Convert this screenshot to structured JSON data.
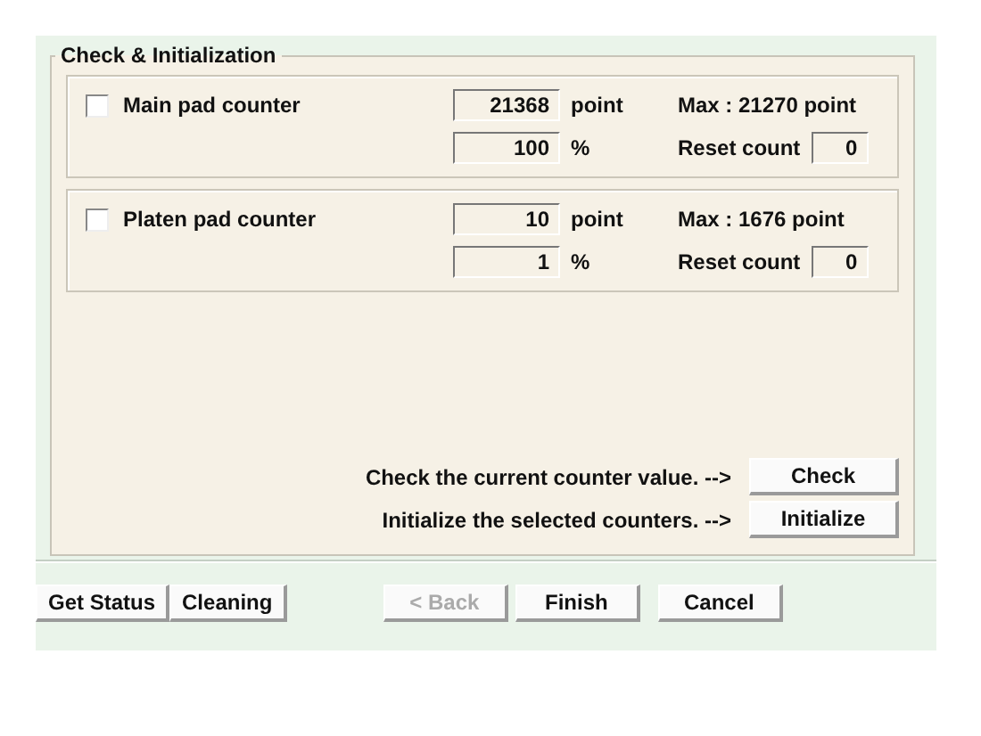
{
  "group": {
    "title": "Check & Initialization"
  },
  "counters": [
    {
      "label": "Main pad counter",
      "checked": false,
      "points": "21368",
      "point_unit": "point",
      "percent": "100",
      "percent_unit": "%",
      "max": "Max : 21270 point",
      "reset_label": "Reset count",
      "reset_count": "0"
    },
    {
      "label": "Platen pad counter",
      "checked": false,
      "points": "10",
      "point_unit": "point",
      "percent": "1",
      "percent_unit": "%",
      "max": "Max : 1676 point",
      "reset_label": "Reset count",
      "reset_count": "0"
    }
  ],
  "actions": [
    {
      "hint": "Check the current counter value. -->",
      "button": "Check"
    },
    {
      "hint": "Initialize the selected counters. -->",
      "button": "Initialize"
    }
  ],
  "footer_left": [
    {
      "label": "Get Status",
      "disabled": false
    },
    {
      "label": "Cleaning",
      "disabled": false
    }
  ],
  "footer_right": [
    {
      "label": "< Back",
      "disabled": true
    },
    {
      "label": "Finish",
      "disabled": false
    },
    {
      "label": "Cancel",
      "disabled": false
    }
  ]
}
